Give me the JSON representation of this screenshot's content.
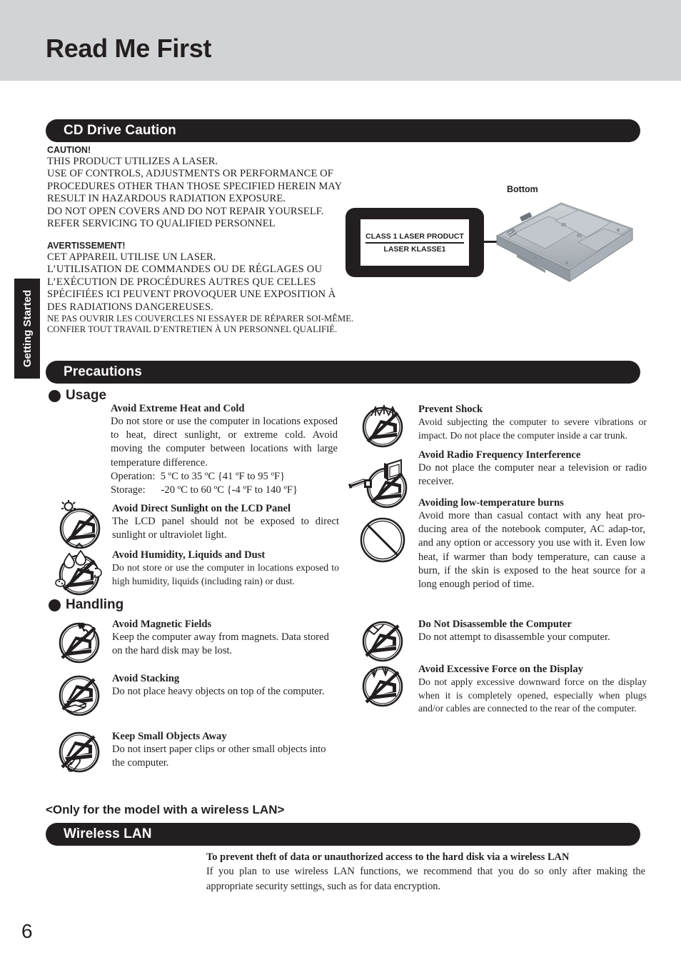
{
  "page": {
    "title": "Read Me First",
    "number": "6",
    "side_tab": "Getting Started"
  },
  "cd_drive_caution": {
    "bar_label": "CD Drive Caution",
    "english": {
      "kicker": "CAUTION!",
      "lines": [
        "THIS PRODUCT UTILIZES A LASER.",
        "USE OF CONTROLS, ADJUSTMENTS OR PERFORMANCE OF",
        "PROCEDURES OTHER THAN THOSE SPECIFIED HEREIN MAY",
        "RESULT IN HAZARDOUS RADIATION EXPOSURE.",
        "DO NOT OPEN COVERS AND DO NOT REPAIR YOURSELF.",
        "REFER SERVICING TO QUALIFIED PERSONNEL"
      ]
    },
    "french": {
      "kicker": "AVERTISSEMENT!",
      "lines": [
        "CET APPAREIL UTILISE UN LASER.",
        "L’UTILISATION  DE  COMMANDES  OU  DE  RÉGLAGES  OU",
        "L’EXÉCUTION  DE  PROCÉDURES  AUTRES  QUE  CELLES",
        "SPÉCIFIÉES ICI PEUVENT PROVOQUER UNE EXPOSITION À",
        "DES RADIATIONS DANGEREUSES."
      ],
      "small_lines": [
        "NE PAS OUVRIR LES COUVERCLES NI ESSAYER DE RÉPARER SOI-MÊME.",
        "CONFIER TOUT TRAVAIL D’ENTRETIEN À UN PERSONNEL QUALIFIÉ."
      ]
    },
    "label_graphic": {
      "line1": "CLASS 1 LASER PRODUCT",
      "line2": "LASER KLASSE1",
      "caption": "Bottom"
    }
  },
  "precautions": {
    "bar_label": "Precautions",
    "usage": {
      "group_label": "Usage",
      "left_items": [
        {
          "icon": "no-extreme-temperature-icon",
          "title": "Avoid Extreme Heat and Cold",
          "body": "Do not store or use the computer in locations exposed to heat, direct sunlight, or extreme cold. Avoid moving the computer between locations with large temperature difference.",
          "temp_operation_label": "Operation:",
          "temp_operation_value": "5 ºC to 35 ºC {41 ºF to 95 ºF}",
          "temp_storage_label": "Storage:",
          "temp_storage_value": "-20 ºC to 60 ºC {-4 ºF to 140 ºF}"
        },
        {
          "icon": "no-direct-sunlight-lcd-icon",
          "title": "Avoid Direct Sunlight on the LCD Panel",
          "body": "The LCD panel should not be exposed to direct sunlight or ultraviolet light."
        },
        {
          "icon": "no-humidity-liquids-dust-icon",
          "title": "Avoid Humidity, Liquids and Dust",
          "body": "Do not store or use the computer in locations exposed to high humidity, liquids (including rain) or dust."
        }
      ],
      "right_items": [
        {
          "icon": "no-shock-impact-icon",
          "title": "Prevent Shock",
          "body": "Avoid subjecting the computer to severe vibrations or impact.  Do not place the computer inside a car trunk."
        },
        {
          "icon": "no-radio-frequency-interference-icon",
          "title": "Avoid Radio Frequency Interference",
          "body": "Do not place the computer near a television or radio receiver."
        },
        {
          "icon": "prohibition-circle-icon",
          "title": "Avoiding low-temperature burns",
          "body": "Avoid more than casual contact with any heat pro-ducing area of  the notebook computer, AC adap-tor, and any option or accessory you use with it. Even low heat, if warmer than body temperature, can cause a burn, if the skin is exposed to the heat source for a long enough period of time."
        }
      ]
    },
    "handling": {
      "group_label": "Handling",
      "left_items": [
        {
          "icon": "no-magnets-icon",
          "title": "Avoid Magnetic Fields",
          "body": "Keep the computer away from magnets. Data stored on the hard disk may be lost."
        },
        {
          "icon": "no-stacking-icon",
          "title": "Avoid Stacking",
          "body": "Do not place heavy objects on top of the computer."
        },
        {
          "icon": "no-small-objects-icon",
          "title": "Keep Small Objects Away",
          "body": "Do not insert paper clips or other small objects into the computer."
        }
      ],
      "right_items": [
        {
          "icon": "no-disassemble-icon",
          "title": "Do Not Disassemble the Computer",
          "body": "Do not attempt to disassemble your computer."
        },
        {
          "icon": "no-excessive-force-display-icon",
          "title": "Avoid Excessive Force on the Display",
          "body": "Do not apply excessive downward force on the display when it is completely opened, especially when plugs and/or cables are connected to the rear of the computer."
        }
      ]
    }
  },
  "wireless_lan": {
    "only_for_note": "<Only for the model with a wireless LAN>",
    "bar_label": "Wireless LAN",
    "title": "To prevent theft of data or unauthorized access to the hard disk via a wireless LAN",
    "body": "If you plan to use wireless LAN functions, we recommend that you do so only after making the appropriate security settings, such as for data encryption."
  },
  "colors": {
    "header_band": "#d2d3d5",
    "ink": "#231f20",
    "paper": "#ffffff"
  }
}
